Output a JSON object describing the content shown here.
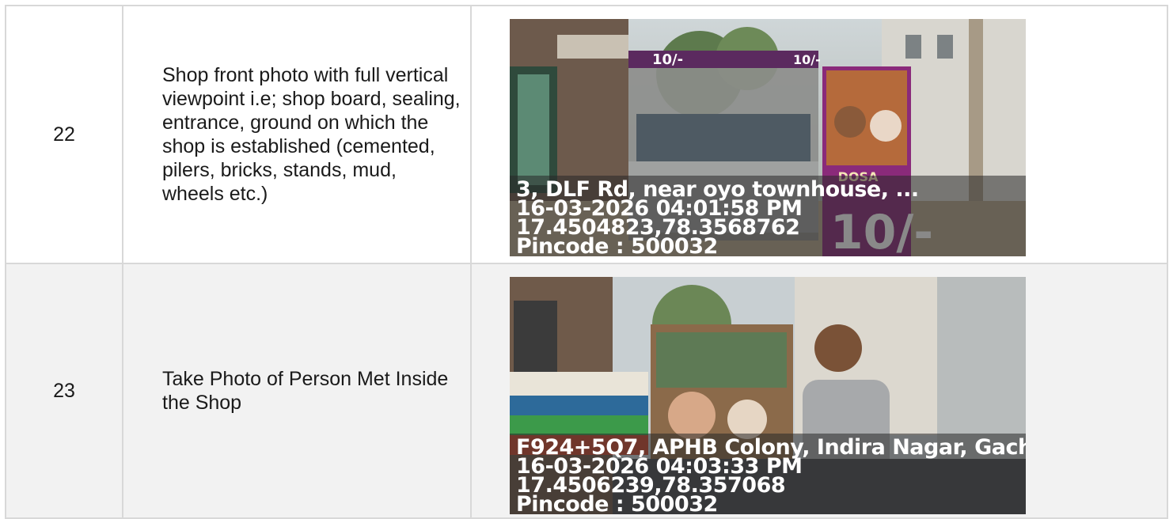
{
  "rows": [
    {
      "number": "22",
      "description": "Shop front photo with full vertical viewpoint i.e; shop board, sealing, entrance, ground on which the shop is established (cemented, pilers, bricks, stands, mud, wheels etc.)",
      "photo": {
        "address": "3, DLF Rd, near oyo townhouse, ...",
        "datetime": "16-03-2026 04:01:58 PM",
        "coords": "17.4504823,78.3568762",
        "pincode": "Pincode : 500032",
        "banner_price": "10/-",
        "stall_price": "10/-"
      }
    },
    {
      "number": "23",
      "description": "Take Photo of Person Met Inside the Shop",
      "photo": {
        "address": "F924+5Q7, APHB Colony, Indira Nagar, Gach",
        "datetime": "16-03-2026 04:03:33 PM",
        "coords": "17.4506239,78.357068",
        "pincode": "Pincode : 500032"
      }
    }
  ],
  "colors": {
    "border": "#d8d8d8",
    "row_alt_bg": "#f2f2f2",
    "banner_purple": "#8a2a7a"
  }
}
